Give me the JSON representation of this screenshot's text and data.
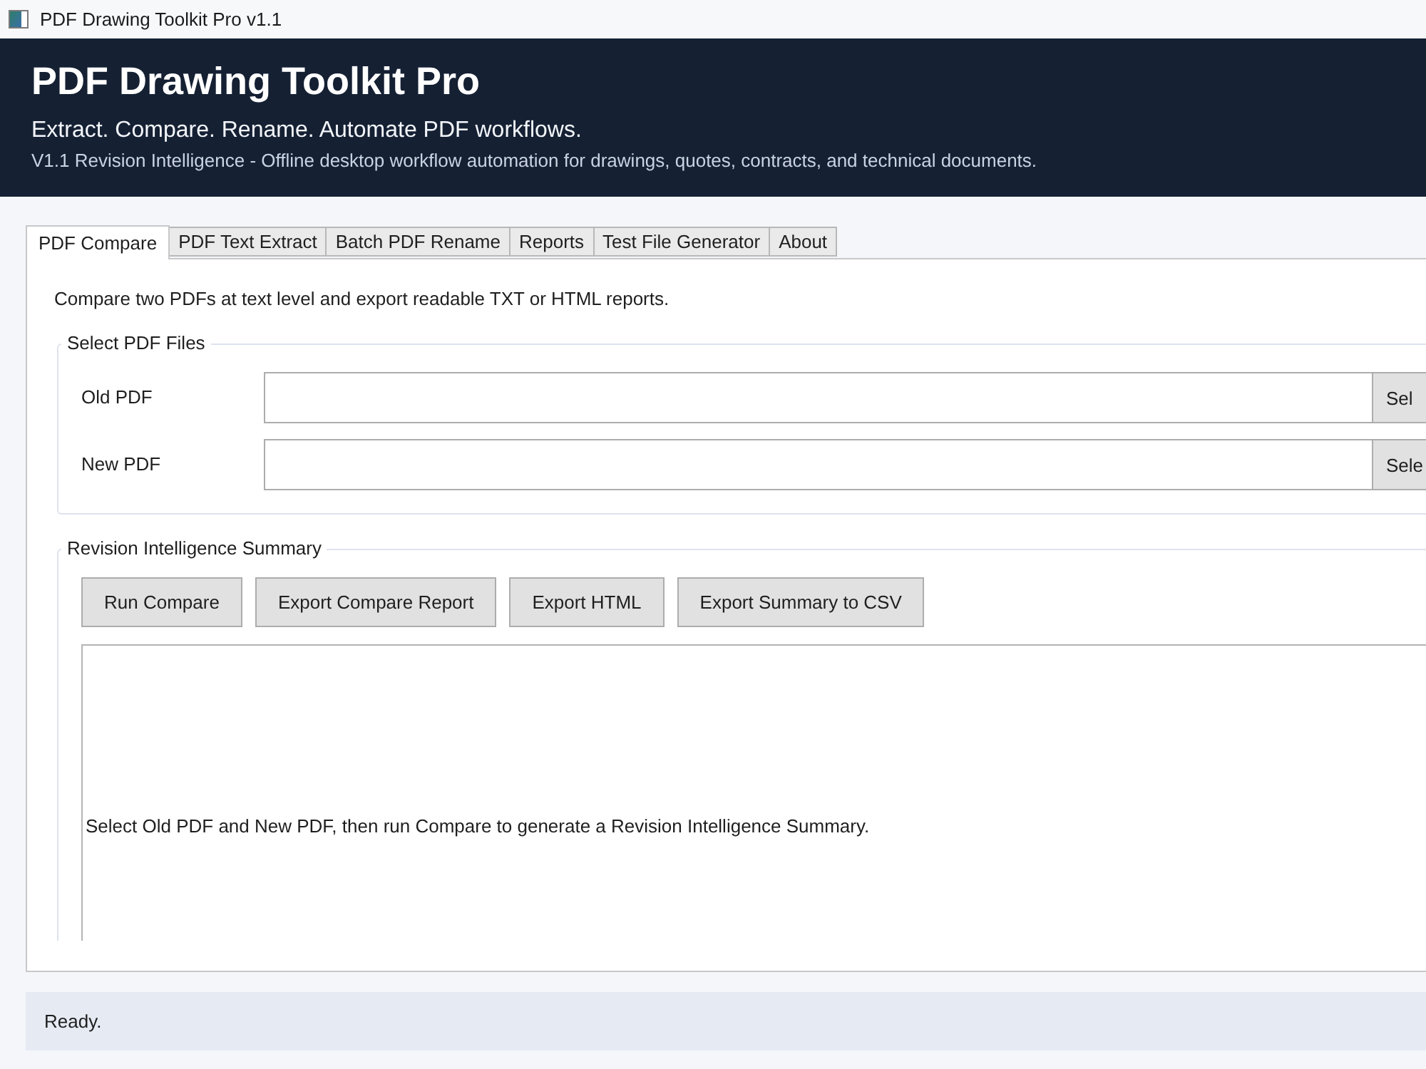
{
  "window": {
    "title": "PDF Drawing Toolkit Pro v1.1"
  },
  "header": {
    "title": "PDF Drawing Toolkit Pro",
    "tagline": "Extract. Compare. Rename. Automate PDF workflows.",
    "description": "V1.1 Revision Intelligence - Offline desktop workflow automation for drawings, quotes, contracts, and technical documents."
  },
  "tabs": [
    {
      "label": "PDF Compare",
      "selected": true
    },
    {
      "label": "PDF Text Extract",
      "selected": false
    },
    {
      "label": "Batch PDF Rename",
      "selected": false
    },
    {
      "label": "Reports",
      "selected": false
    },
    {
      "label": "Test File Generator",
      "selected": false
    },
    {
      "label": "About",
      "selected": false
    }
  ],
  "compare_tab": {
    "intro": "Compare two PDFs at text level and export readable TXT or HTML reports.",
    "file_group": {
      "title": "Select PDF Files",
      "rows": [
        {
          "label": "Old PDF",
          "button": "Sel"
        },
        {
          "label": "New PDF",
          "button": "Sele"
        }
      ]
    },
    "summary_group": {
      "title": "Revision Intelligence Summary",
      "buttons": [
        "Run Compare",
        "Export Compare Report",
        "Export HTML",
        "Export Summary to CSV"
      ],
      "output": "Select Old PDF and New PDF, then run Compare to generate a Revision Intelligence Summary."
    }
  },
  "status_bar": {
    "text": "Ready."
  }
}
